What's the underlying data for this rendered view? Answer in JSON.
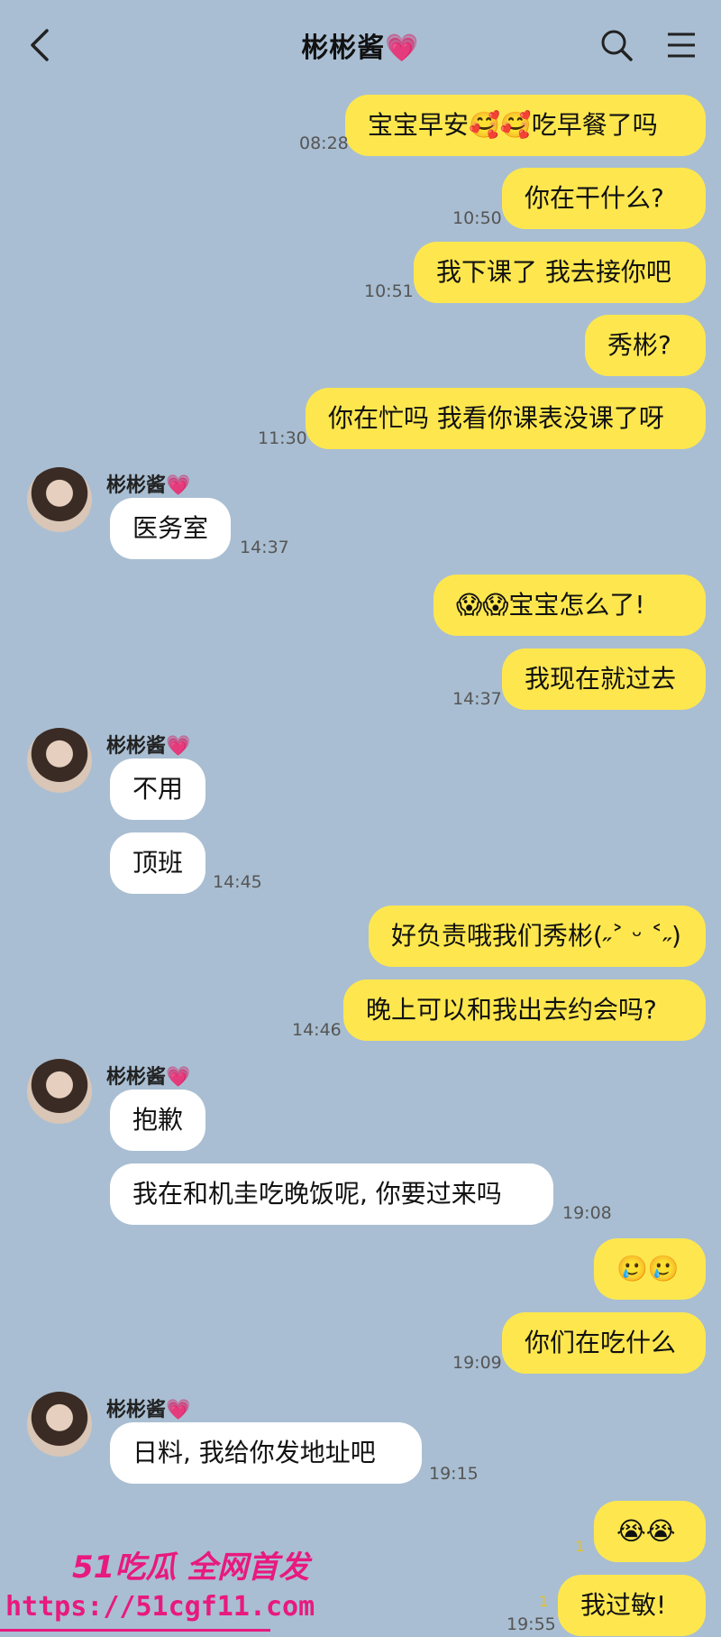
{
  "header": {
    "title": "彬彬酱",
    "title_icon": "heart-emoji"
  },
  "contact": {
    "name": "彬彬酱",
    "name_icon": "heart-emoji"
  },
  "messages": [
    {
      "dir": "sent",
      "text": "宝宝早安🥰🥰吃早餐了吗",
      "time": "08:28"
    },
    {
      "dir": "sent",
      "text": "你在干什么?",
      "time": "10:50"
    },
    {
      "dir": "sent",
      "text": "我下课了 我去接你吧",
      "time": "10:51"
    },
    {
      "dir": "sent",
      "text": "秀彬?",
      "time": ""
    },
    {
      "dir": "sent",
      "text": "你在忙吗 我看你课表没课了呀",
      "time": "11:30"
    },
    {
      "dir": "recv",
      "text": "医务室",
      "time": "14:37"
    },
    {
      "dir": "sent",
      "text": "😱😱宝宝怎么了!",
      "time": ""
    },
    {
      "dir": "sent",
      "text": "我现在就过去",
      "time": "14:37"
    },
    {
      "dir": "recv",
      "text": "不用",
      "time": ""
    },
    {
      "dir": "recv",
      "text": "顶班",
      "time": "14:45"
    },
    {
      "dir": "sent",
      "text": "好负责哦我们秀彬(˶˃ ᵕ ˂˶)",
      "time": ""
    },
    {
      "dir": "sent",
      "text": "晚上可以和我出去约会吗?",
      "time": "14:46"
    },
    {
      "dir": "recv",
      "text": "抱歉",
      "time": ""
    },
    {
      "dir": "recv",
      "text": "我在和机圭吃晚饭呢, 你要过来吗",
      "time": "19:08"
    },
    {
      "dir": "sent",
      "text": "🥲🥲",
      "time": ""
    },
    {
      "dir": "sent",
      "text": "你们在吃什么",
      "time": "19:09"
    },
    {
      "dir": "recv",
      "text": "日料, 我给你发地址吧",
      "time": "19:15"
    },
    {
      "dir": "sent",
      "text": "😭😭",
      "time": "",
      "unread": "1"
    },
    {
      "dir": "sent",
      "text": "我过敏!",
      "time": "19:55",
      "unread": "1"
    }
  ],
  "watermark": {
    "brand": "51吃瓜 全网首发",
    "url": "https://51cgf11.com"
  },
  "colors": {
    "background": "#a9bed2",
    "sent_bubble": "#fee74e",
    "recv_bubble": "#ffffff",
    "watermark": "#e8197f"
  }
}
